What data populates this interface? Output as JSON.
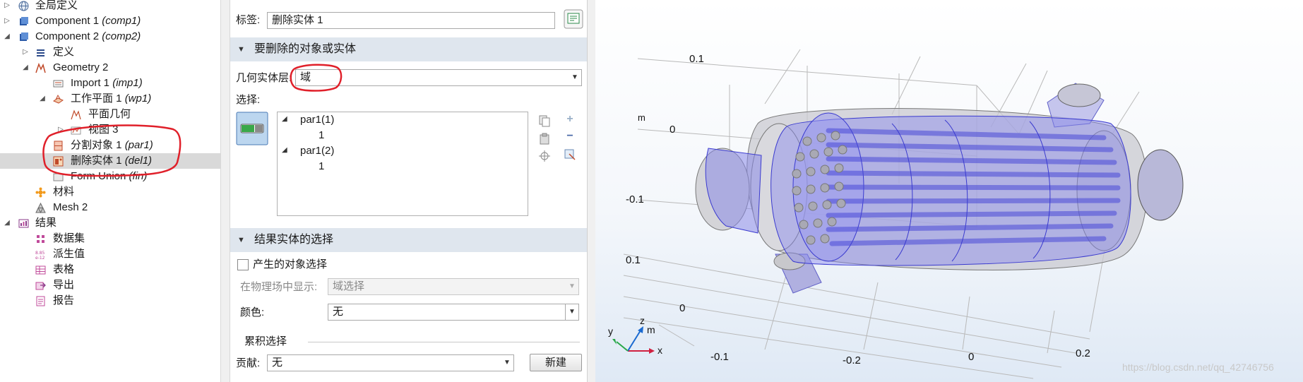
{
  "tree": {
    "items": [
      {
        "label": "全局定义",
        "tag": ""
      },
      {
        "label": "Component 1",
        "tag": "(comp1)"
      },
      {
        "label": "Component 2",
        "tag": "(comp2)"
      },
      {
        "label": "定义",
        "tag": ""
      },
      {
        "label": "Geometry 2",
        "tag": ""
      },
      {
        "label": "Import 1",
        "tag": "(imp1)"
      },
      {
        "label": "工作平面 1",
        "tag": "(wp1)"
      },
      {
        "label": "平面几何",
        "tag": ""
      },
      {
        "label": "视图 3",
        "tag": ""
      },
      {
        "label": "分割对象 1",
        "tag": "(par1)"
      },
      {
        "label": "删除实体 1",
        "tag": "(del1)"
      },
      {
        "label": "Form Union",
        "tag": "(fin)"
      },
      {
        "label": "材料",
        "tag": ""
      },
      {
        "label": "Mesh 2",
        "tag": ""
      },
      {
        "label": "结果",
        "tag": ""
      },
      {
        "label": "数据集",
        "tag": ""
      },
      {
        "label": "派生值",
        "tag": ""
      },
      {
        "label": "表格",
        "tag": ""
      },
      {
        "label": "导出",
        "tag": ""
      },
      {
        "label": "报告",
        "tag": ""
      }
    ]
  },
  "settings": {
    "tag_label": "标签:",
    "tag_value": "删除实体 1",
    "section1_title": "要删除的对象或实体",
    "geom_level_label": "几何实体层:",
    "geom_level_value": "域",
    "selection_label": "选择:",
    "selection_items": [
      "par1(1)",
      "1",
      "par1(2)",
      "1"
    ],
    "section2_title": "结果实体的选择",
    "result_checkbox_label": "产生的对象选择",
    "show_in_physics_label": "在物理场中显示:",
    "show_in_physics_value": "域选择",
    "color_label": "颜色:",
    "color_value": "无",
    "cumulative_label": "累积选择",
    "contribute_label": "贡献:",
    "contribute_value": "无",
    "new_button": "新建"
  },
  "graphics": {
    "axis_labels": {
      "z_top": "0.1",
      "z_unit": "m",
      "z_mid": "0",
      "z_low": "-0.1",
      "y_hi": "0.1",
      "y_zero": "0",
      "x_1": "-0.1",
      "x_2": "-0.2",
      "x_3": "0",
      "x_4": "0.2"
    },
    "triad": {
      "x": "x",
      "y": "y",
      "z": "z",
      "m": "m"
    },
    "watermark": "https://blog.csdn.net/qq_42746756"
  },
  "colors": {
    "annotation": "#e0202a",
    "section_bg": "#dfe6ee",
    "selection": "#6a6ae8"
  }
}
